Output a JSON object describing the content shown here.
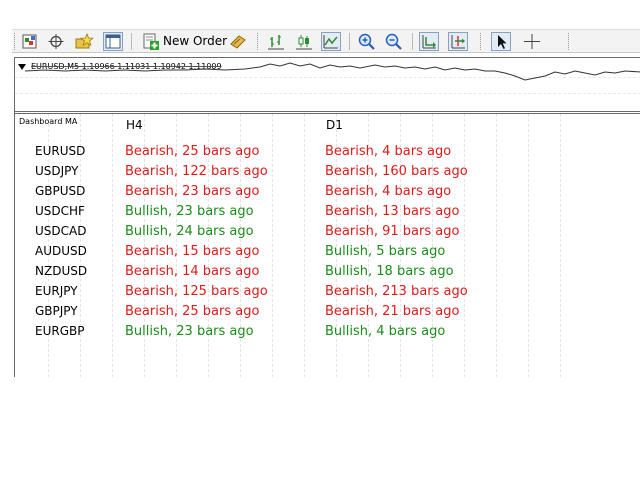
{
  "toolbar": {
    "new_order_label": "New Order",
    "buttons": [
      "new-chart-icon",
      "crosshair-move-icon",
      "favorites-icon",
      "navigator-icon",
      "new-order-icon",
      "expert-advisors-icon",
      "bar-chart-icon",
      "candlestick-icon",
      "line-chart-icon",
      "zoom-in-icon",
      "zoom-out-icon",
      "chart-shift-icon",
      "auto-scroll-icon",
      "cursor-icon",
      "crosshair-icon"
    ]
  },
  "price_panel": {
    "caption": "EURUSD,M5  1.10966 1.11031 1.10942 1.11009"
  },
  "dashboard": {
    "title": "Dashboard MA",
    "columns": [
      "H4",
      "D1"
    ],
    "rows": [
      {
        "symbol": "EURUSD",
        "h4": "Bearish, 25 bars ago",
        "h4_trend": "bearish",
        "d1": "Bearish, 4 bars ago",
        "d1_trend": "bearish"
      },
      {
        "symbol": "USDJPY",
        "h4": "Bearish, 122 bars ago",
        "h4_trend": "bearish",
        "d1": "Bearish, 160 bars ago",
        "d1_trend": "bearish"
      },
      {
        "symbol": "GBPUSD",
        "h4": "Bearish, 23 bars ago",
        "h4_trend": "bearish",
        "d1": "Bearish, 4 bars ago",
        "d1_trend": "bearish"
      },
      {
        "symbol": "USDCHF",
        "h4": "Bullish, 23 bars ago",
        "h4_trend": "bullish",
        "d1": "Bearish, 13 bars ago",
        "d1_trend": "bearish"
      },
      {
        "symbol": "USDCAD",
        "h4": "Bullish, 24 bars ago",
        "h4_trend": "bullish",
        "d1": "Bearish, 91 bars ago",
        "d1_trend": "bearish"
      },
      {
        "symbol": "AUDUSD",
        "h4": "Bearish, 15 bars ago",
        "h4_trend": "bearish",
        "d1": "Bullish, 5 bars ago",
        "d1_trend": "bullish"
      },
      {
        "symbol": "NZDUSD",
        "h4": "Bearish, 14 bars ago",
        "h4_trend": "bearish",
        "d1": "Bullish, 18 bars ago",
        "d1_trend": "bullish"
      },
      {
        "symbol": "EURJPY",
        "h4": "Bearish, 125 bars ago",
        "h4_trend": "bearish",
        "d1": "Bearish, 213 bars ago",
        "d1_trend": "bearish"
      },
      {
        "symbol": "GBPJPY",
        "h4": "Bearish, 25 bars ago",
        "h4_trend": "bearish",
        "d1": "Bearish, 21 bars ago",
        "d1_trend": "bearish"
      },
      {
        "symbol": "EURGBP",
        "h4": "Bullish, 23 bars ago",
        "h4_trend": "bullish",
        "d1": "Bullish, 4 bars ago",
        "d1_trend": "bullish"
      }
    ]
  },
  "colors": {
    "bearish": "#e01a1a",
    "bullish": "#1a8c1a"
  }
}
